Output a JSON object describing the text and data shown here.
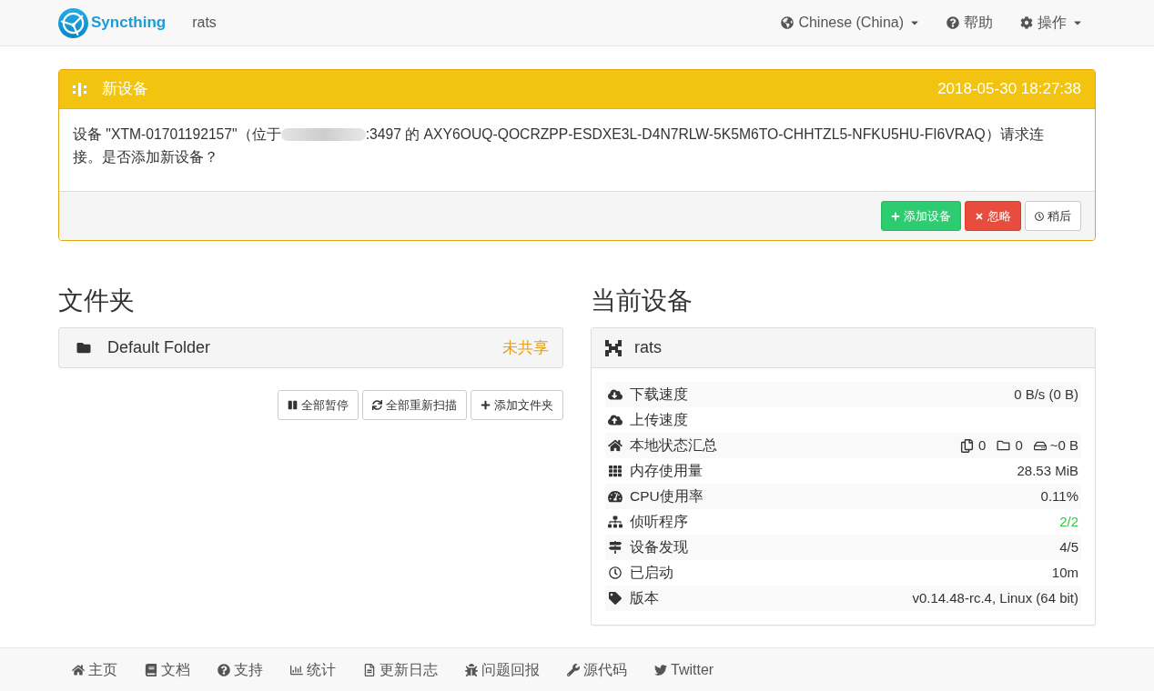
{
  "navbar": {
    "brand": "Syncthing",
    "device_name": "rats",
    "menu": [
      {
        "kind": "language",
        "label": "Chinese (China)",
        "dropdown": true
      },
      {
        "kind": "help",
        "label": "帮助",
        "dropdown": false
      },
      {
        "kind": "actions",
        "label": "操作",
        "dropdown": true
      }
    ]
  },
  "notification": {
    "title": "新设备",
    "time": "2018-05-30 18:27:38",
    "message_before": "设备 \"XTM-01701192157\"（位于",
    "message_after": ":3497 的 AXY6OUQ-QOCRZPP-ESDXE3L-D4N7RLW-5K5M6TO-CHHTZL5-NFKU5HU-FI6VRAQ）请求连",
    "message_end": "接。是否添加新设备？",
    "buttons": [
      {
        "kind": "add",
        "label": "添加设备"
      },
      {
        "kind": "ignore",
        "label": "忽略"
      },
      {
        "kind": "later",
        "label": "稍后"
      }
    ]
  },
  "folders": {
    "heading": "文件夹",
    "items": [
      {
        "name": "Default Folder",
        "status": "未共享"
      }
    ],
    "buttons": [
      {
        "kind": "pause",
        "label": "全部暂停"
      },
      {
        "kind": "rescan",
        "label": "全部重新扫描"
      },
      {
        "kind": "add",
        "label": "添加文件夹"
      }
    ]
  },
  "this_device": {
    "heading": "当前设备",
    "name": "rats",
    "rows": [
      {
        "kind": "download",
        "label": "下载速度",
        "value": "0 B/s (0 B)"
      },
      {
        "kind": "upload",
        "label": "上传速度"
      },
      {
        "kind": "local_state",
        "label": "本地状态汇总",
        "files": "0",
        "directories": "0",
        "size": "~0 B"
      },
      {
        "kind": "memory",
        "label": "内存使用量",
        "value": "28.53 MiB"
      },
      {
        "kind": "cpu",
        "label": "CPU使用率",
        "value": "0.11%"
      },
      {
        "kind": "listeners",
        "label": "侦听程序",
        "value": "2/2",
        "ok": true
      },
      {
        "kind": "discovery",
        "label": "设备发现",
        "value": "4/5",
        "ok": false
      },
      {
        "kind": "uptime",
        "label": "已启动",
        "value": "10m"
      },
      {
        "kind": "version",
        "label": "版本",
        "value": "v0.14.48-rc.4, Linux (64 bit)"
      }
    ]
  },
  "footer": {
    "links": [
      {
        "kind": "home",
        "label": "主页"
      },
      {
        "kind": "docs",
        "label": "文档"
      },
      {
        "kind": "support",
        "label": "支持"
      },
      {
        "kind": "stats",
        "label": "统计"
      },
      {
        "kind": "changelog",
        "label": "更新日志"
      },
      {
        "kind": "bugs",
        "label": "问题回报"
      },
      {
        "kind": "source",
        "label": "源代码"
      },
      {
        "kind": "twitter",
        "label": "Twitter"
      }
    ]
  }
}
